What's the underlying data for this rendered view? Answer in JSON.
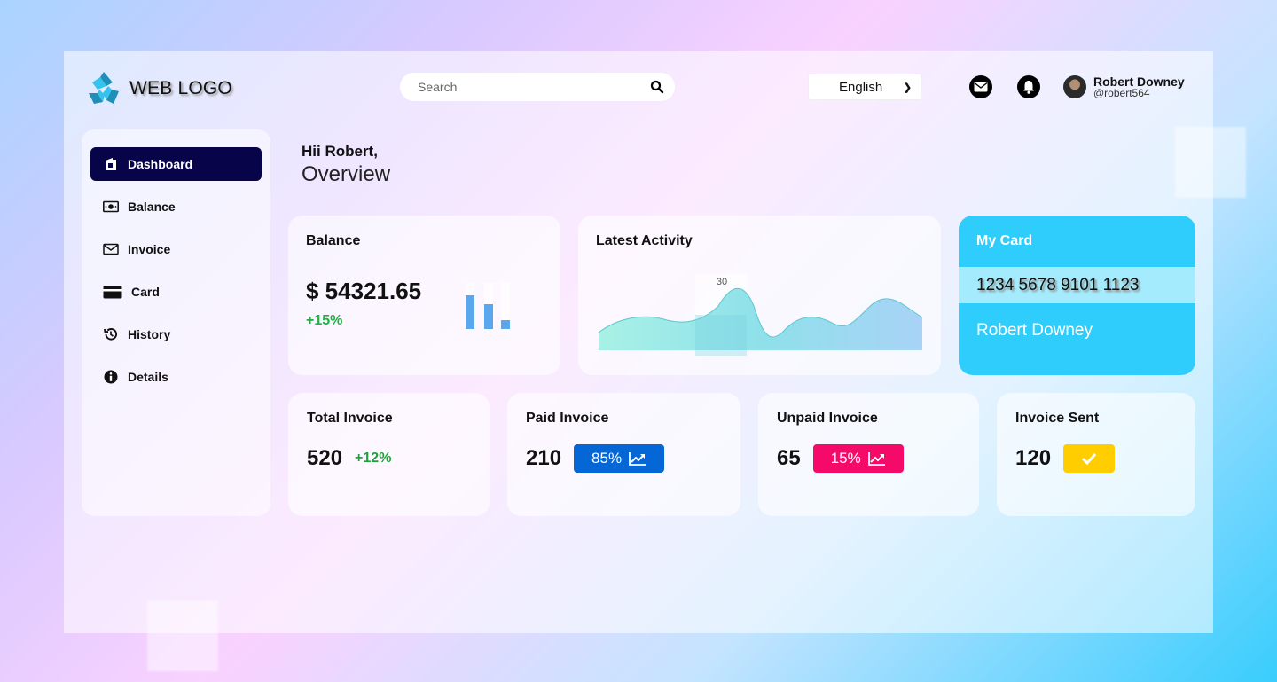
{
  "header": {
    "logo_text": "WEB LOGO",
    "search_placeholder": "Search",
    "language": "English",
    "user_name": "Robert Downey",
    "user_handle": "@robert564"
  },
  "sidebar": {
    "items": [
      {
        "label": "Dashboard",
        "icon": "dashboard-icon",
        "active": true
      },
      {
        "label": "Balance",
        "icon": "money-icon"
      },
      {
        "label": "Invoice",
        "icon": "envelope-icon"
      },
      {
        "label": "Card",
        "icon": "credit-card-icon"
      },
      {
        "label": "History",
        "icon": "history-icon"
      },
      {
        "label": "Details",
        "icon": "info-icon"
      }
    ]
  },
  "greeting": {
    "hello": "Hii Robert,",
    "title": "Overview"
  },
  "balance": {
    "title": "Balance",
    "amount": "$ 54321.65",
    "change": "+15%"
  },
  "activity": {
    "title": "Latest Activity",
    "tooltip": "30"
  },
  "my_card": {
    "title": "My Card",
    "number": "1234 5678 9101 1123",
    "holder": "Robert Downey"
  },
  "stats": {
    "total": {
      "title": "Total Invoice",
      "value": "520",
      "change": "+12%"
    },
    "paid": {
      "title": "Paid Invoice",
      "value": "210",
      "badge": "85%"
    },
    "unpaid": {
      "title": "Unpaid Invoice",
      "value": "65",
      "badge": "15%"
    },
    "sent": {
      "title": "Invoice Sent",
      "value": "120"
    }
  },
  "colors": {
    "nav_active": "#08044a",
    "card_accent": "#2fcdfb",
    "paid_badge": "#0566d6",
    "unpaid_badge": "#f50a6a",
    "sent_badge": "#ffcd00",
    "positive": "#1fb141"
  }
}
